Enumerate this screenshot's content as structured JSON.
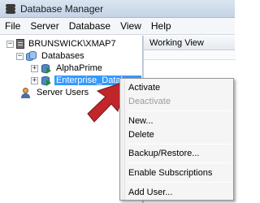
{
  "window": {
    "title": "Database Manager"
  },
  "menu": [
    "File",
    "Server",
    "Database",
    "View",
    "Help"
  ],
  "tree": {
    "server": "BRUNSWICK\\XMAP7",
    "databases_label": "Databases",
    "db1": "AlphaPrime",
    "db2": "Enterprise_Database",
    "users_label": "Server Users"
  },
  "right_pane": {
    "header": "Working View"
  },
  "context_menu": {
    "activate": "Activate",
    "deactivate": "Deactivate",
    "new": "New...",
    "delete": "Delete",
    "backup": "Backup/Restore...",
    "subscriptions": "Enable Subscriptions",
    "add_user": "Add User..."
  },
  "colors": {
    "selection": "#3399ff",
    "arrow": "#c0262a"
  }
}
